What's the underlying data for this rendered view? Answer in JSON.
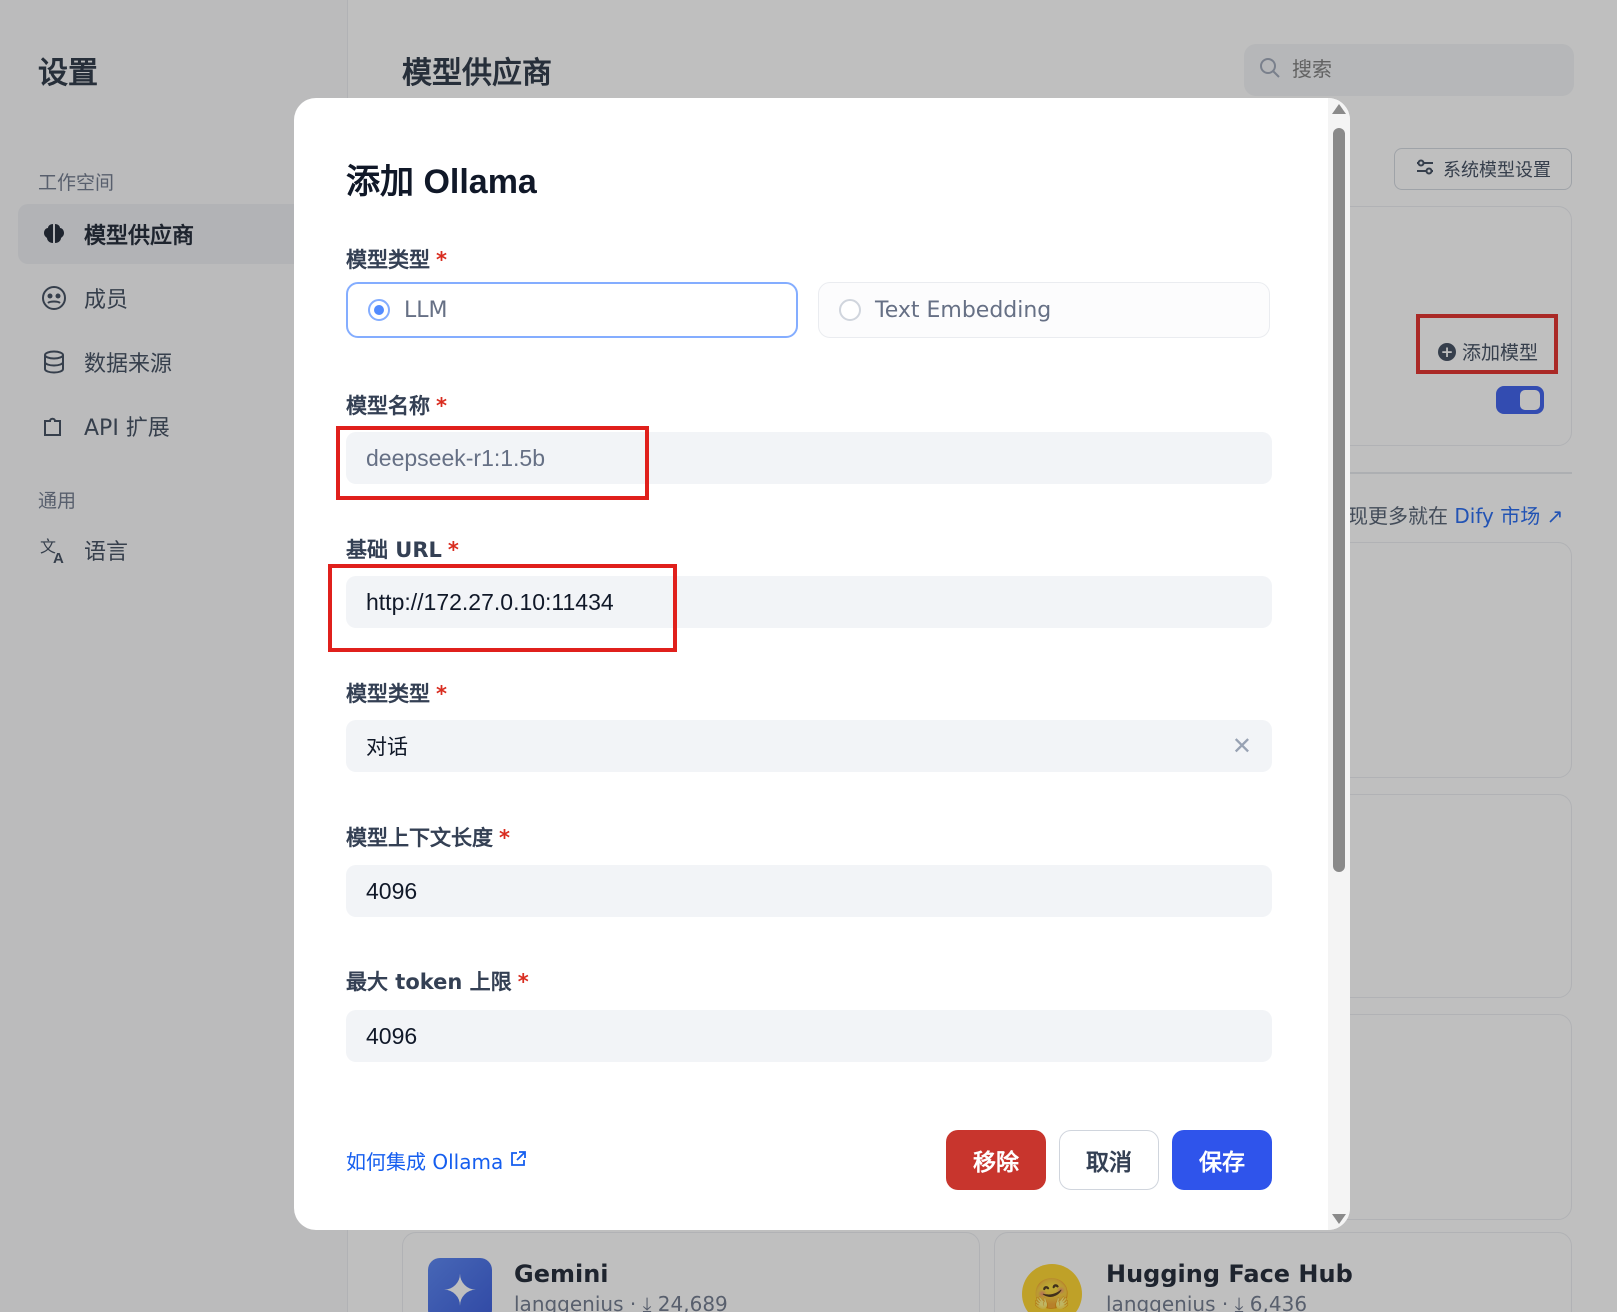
{
  "sidebar": {
    "title": "设置",
    "workspace_label": "工作空间",
    "general_label": "通用",
    "items": [
      {
        "label": "模型供应商",
        "icon": "brain-icon"
      },
      {
        "label": "成员",
        "icon": "members-icon"
      },
      {
        "label": "数据来源",
        "icon": "database-icon"
      },
      {
        "label": "API 扩展",
        "icon": "puzzle-icon"
      },
      {
        "label": "语言",
        "icon": "translate-icon"
      }
    ]
  },
  "main": {
    "title": "模型供应商",
    "search_placeholder": "搜索",
    "system_model_settings": "系统模型设置",
    "add_model": "添加模型",
    "toggle_on": true,
    "market_prefix": "现更多就在",
    "market_link": "Dify 市场",
    "providers": [
      {
        "name": "Gemini",
        "author": "langgenius",
        "installs": "24,689"
      },
      {
        "name": "Hugging Face Hub",
        "author": "langgenius",
        "installs": "6,436"
      }
    ]
  },
  "modal": {
    "title": "添加 Ollama",
    "model_type_label": "模型类型",
    "model_type_options": [
      "LLM",
      "Text Embedding"
    ],
    "model_type_selected": "LLM",
    "model_name_label": "模型名称",
    "model_name_value": "deepseek-r1:1.5b",
    "base_url_label": "基础 URL",
    "base_url_value": "http://172.27.0.10:11434",
    "mode_label": "模型类型",
    "mode_value": "对话",
    "context_length_label": "模型上下文长度",
    "context_length_value": "4096",
    "max_tokens_label": "最大 token 上限",
    "max_tokens_value": "4096",
    "required_mark": "*",
    "help_link": "如何集成 Ollama",
    "remove_button": "移除",
    "cancel_button": "取消",
    "save_button": "保存"
  },
  "colors": {
    "accent": "#2f54eb",
    "danger": "#c8352d",
    "highlight": "#e0201c",
    "link": "#155eef"
  }
}
